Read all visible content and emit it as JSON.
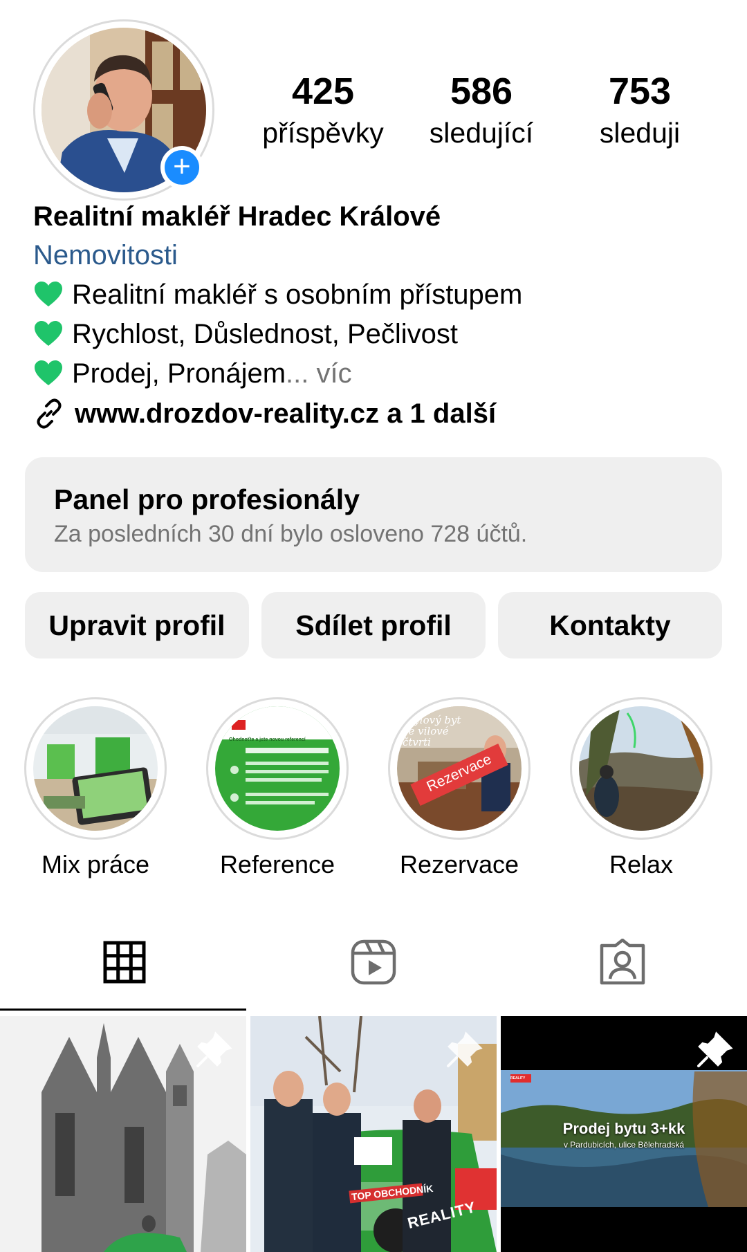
{
  "profile": {
    "stats": [
      {
        "value": "425",
        "label": "příspěvky"
      },
      {
        "value": "586",
        "label": "sledující"
      },
      {
        "value": "753",
        "label": "sleduji"
      }
    ],
    "name": "Realitní makléř Hradec Králové",
    "category": "Nemovitosti",
    "bio": [
      "Realitní makléř s osobním přístupem",
      "Rychlost, Důslednost, Pečlivost",
      "Prodej, Pronájem"
    ],
    "bio_ellipsis": "... ",
    "more_label": "víc",
    "link": "www.drozdov-reality.cz a 1 další"
  },
  "dashboard": {
    "title": "Panel pro profesionály",
    "subtitle": "Za posledních 30 dní bylo osloveno 728 účtů."
  },
  "actions": {
    "edit": "Upravit profil",
    "share": "Sdílet profil",
    "contacts": "Kontakty"
  },
  "highlights": [
    {
      "label": "Mix práce"
    },
    {
      "label": "Reference"
    },
    {
      "label": "Rezervace"
    },
    {
      "label": "Relax"
    }
  ],
  "highlight_texts": {
    "reference_header": "Ohodnoťte a jste novou referencí",
    "rezervace_title": "Stylový byt ve vilové čtvrti",
    "rezervace_stamp": "Rezervace"
  },
  "tabs": [
    {
      "icon": "grid-icon",
      "active": true
    },
    {
      "icon": "reels-icon",
      "active": false
    },
    {
      "icon": "tagged-icon",
      "active": false
    }
  ],
  "posts": [
    {
      "pinned": true,
      "caption": ""
    },
    {
      "pinned": true,
      "caption": "TOP OBCHODNÍK",
      "brand": "REALITY"
    },
    {
      "pinned": true,
      "caption": "Prodej bytu 3+kk",
      "subcaption": "v Pardubicích, ulice Bělehradská",
      "brand": "REALITY"
    }
  ],
  "colors": {
    "accent_blue": "#1a8cff",
    "category_text": "#2b5a8c",
    "button_bg": "#efefef",
    "muted_text": "#737373",
    "heart": "#1fc46a"
  }
}
